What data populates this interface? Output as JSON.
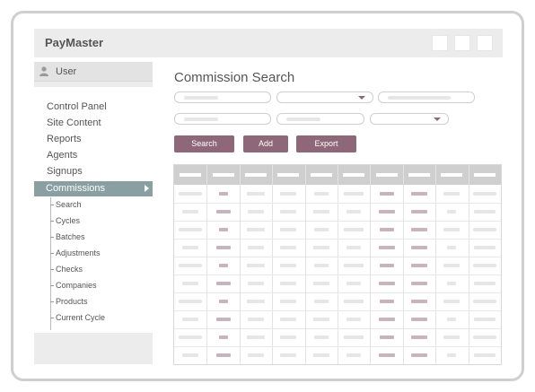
{
  "app": {
    "title": "PayMaster"
  },
  "window_controls": [
    {
      "name": "window-control-1"
    },
    {
      "name": "window-control-2"
    },
    {
      "name": "window-control-3"
    }
  ],
  "user": {
    "label": "User",
    "icon": "user-icon"
  },
  "nav": {
    "items": [
      "Control Panel",
      "Site Content",
      "Reports",
      "Agents",
      "Signups"
    ],
    "active": "Commissions",
    "sub_items": [
      "Search",
      "Cycles",
      "Batches",
      "Adjustments",
      "Checks",
      "Companies",
      "Products",
      "Current Cycle"
    ]
  },
  "main": {
    "title": "Commission Search",
    "buttons": {
      "search": "Search",
      "add": "Add",
      "export": "Export"
    }
  },
  "colors": {
    "accent": "#8e6878",
    "nav_active": "#8a9fa1",
    "header_bg": "#ececec",
    "grid_header": "#cfcfcf",
    "cell_dark": "#c9b4bd",
    "cell_light": "#e6e6e6"
  }
}
